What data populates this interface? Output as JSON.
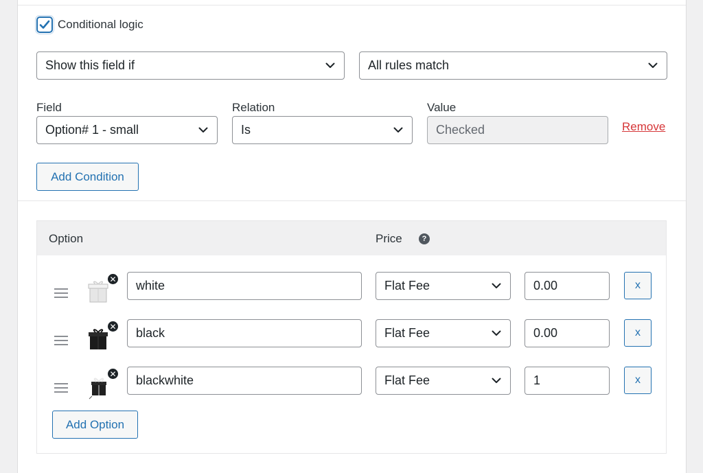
{
  "conditional_logic": {
    "label": "Conditional logic",
    "checked": true
  },
  "visibility": {
    "action": "Show this field if",
    "match": "All rules match"
  },
  "condition_columns": {
    "field": "Field",
    "relation": "Relation",
    "value": "Value"
  },
  "condition": {
    "field": "Option# 1 - small",
    "relation": "Is",
    "value": "Checked",
    "remove_label": "Remove"
  },
  "add_condition_label": "Add Condition",
  "options_table": {
    "option_header": "Option",
    "price_header": "Price",
    "help_icon": "?",
    "rows": [
      {
        "name": "white",
        "price_type": "Flat Fee",
        "price": "0.00",
        "remove_label": "x",
        "thumb_color": "#e8e8e8"
      },
      {
        "name": "black",
        "price_type": "Flat Fee",
        "price": "0.00",
        "remove_label": "x",
        "thumb_color": "#1b1b1b"
      },
      {
        "name": "blackwhite",
        "price_type": "Flat Fee",
        "price": "1",
        "remove_label": "x",
        "thumb_color": "#202020"
      }
    ],
    "thumb_remove_glyph": "✕",
    "add_option_label": "Add Option"
  },
  "colors": {
    "accent": "#2271b1",
    "danger": "#d63638",
    "border": "#8c8f94"
  }
}
